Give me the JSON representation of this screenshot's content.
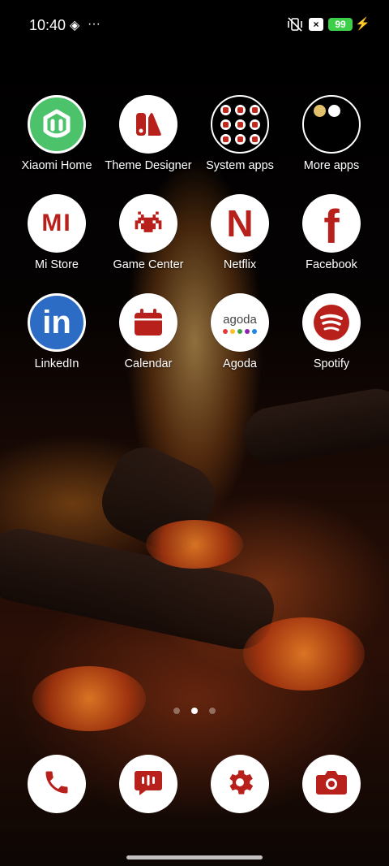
{
  "status_bar": {
    "time": "10:40",
    "more": "···",
    "battery": "99",
    "colors": {
      "battery_fill": "#3ecf4a"
    }
  },
  "apps": [
    {
      "label": "Xiaomi Home",
      "icon": "mi-home-icon"
    },
    {
      "label": "Theme Designer",
      "icon": "theme-designer-icon"
    },
    {
      "label": "System apps",
      "icon": "folder-icon"
    },
    {
      "label": "More apps",
      "icon": "folder-icon"
    },
    {
      "label": "Mi Store",
      "icon": "mi-store-icon",
      "mark": "MI"
    },
    {
      "label": "Game Center",
      "icon": "space-invader-icon"
    },
    {
      "label": "Netflix",
      "icon": "netflix-icon",
      "mark": "N"
    },
    {
      "label": "Facebook",
      "icon": "facebook-icon",
      "mark": "f"
    },
    {
      "label": "LinkedIn",
      "icon": "linkedin-icon",
      "mark": "in"
    },
    {
      "label": "Calendar",
      "icon": "calendar-icon"
    },
    {
      "label": "Agoda",
      "icon": "agoda-icon",
      "mark": "agoda"
    },
    {
      "label": "Spotify",
      "icon": "spotify-icon"
    }
  ],
  "page_indicator": {
    "pages": 3,
    "active": 2
  },
  "dock": [
    {
      "icon": "phone-icon"
    },
    {
      "icon": "messaging-icon"
    },
    {
      "icon": "settings-gear-icon"
    },
    {
      "icon": "camera-icon"
    }
  ],
  "colors": {
    "accent_red": "#b8201b",
    "mi_home_green": "#4cc36a",
    "linkedin_blue": "#2d6cc4"
  }
}
